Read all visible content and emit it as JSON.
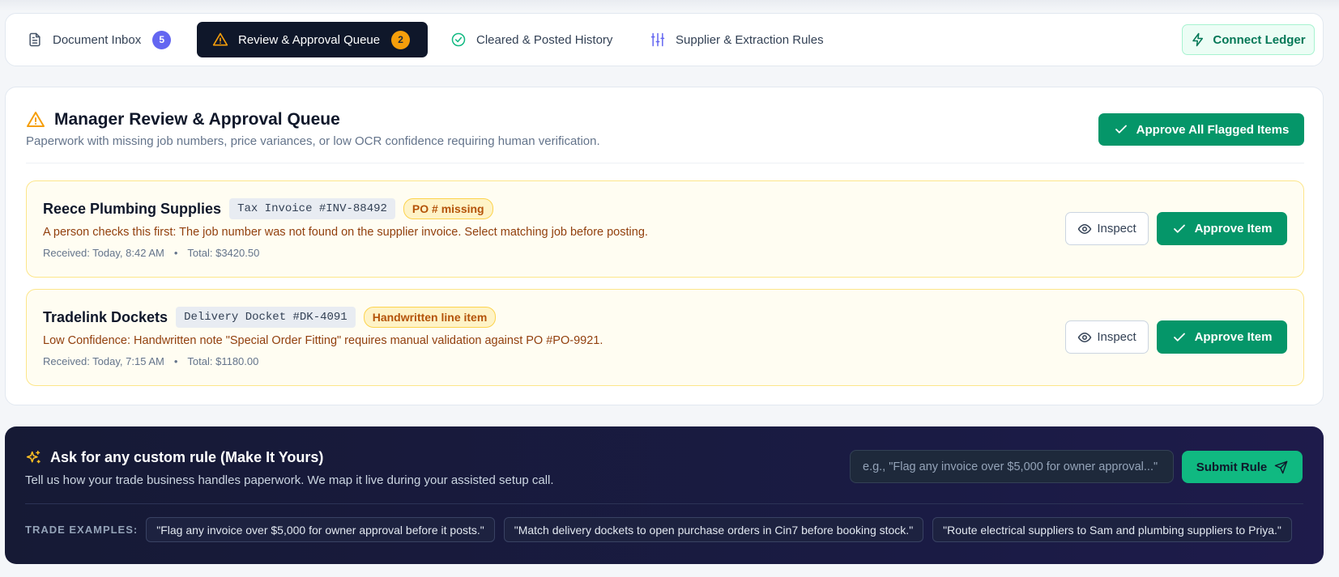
{
  "nav": {
    "tabs": [
      {
        "label": "Document Inbox",
        "count": "5",
        "icon": "document-icon"
      },
      {
        "label": "Review & Approval Queue",
        "count": "2",
        "icon": "warning-icon"
      },
      {
        "label": "Cleared & Posted History",
        "icon": "check-circle-icon"
      },
      {
        "label": "Supplier & Extraction Rules",
        "icon": "sliders-icon"
      }
    ],
    "connect_label": "Connect Ledger"
  },
  "review": {
    "title": "Manager Review & Approval Queue",
    "subtitle": "Paperwork with missing job numbers, price variances, or low OCR confidence requiring human verification.",
    "approve_all_label": "Approve All Flagged Items",
    "items": [
      {
        "supplier": "Reece Plumbing Supplies",
        "doc_ref": "Tax Invoice #INV-88492",
        "flag": "PO # missing",
        "message": "A person checks this first: The job number was not found on the supplier invoice. Select matching job before posting.",
        "received": "Received: Today, 8:42 AM",
        "total": "Total: $3420.50",
        "inspect_label": "Inspect",
        "approve_label": "Approve Item"
      },
      {
        "supplier": "Tradelink Dockets",
        "doc_ref": "Delivery Docket #DK-4091",
        "flag": "Handwritten line item",
        "message": "Low Confidence: Handwritten note \"Special Order Fitting\" requires manual validation against PO #PO-9921.",
        "received": "Received: Today, 7:15 AM",
        "total": "Total: $1180.00",
        "inspect_label": "Inspect",
        "approve_label": "Approve Item"
      }
    ]
  },
  "custom_rule": {
    "title": "Ask for any custom rule (Make It Yours)",
    "subtitle": "Tell us how your trade business handles paperwork. We map it live during your assisted setup call.",
    "input_placeholder": "e.g., \"Flag any invoice over $5,000 for owner approval...\"",
    "submit_label": "Submit Rule",
    "examples_label": "TRADE EXAMPLES:",
    "examples": [
      "\"Flag any invoice over $5,000 for owner approval before it posts.\"",
      "\"Match delivery dockets to open purchase orders in Cin7 before booking stock.\"",
      "\"Route electrical suppliers to Sam and plumbing suppliers to Priya.\""
    ]
  },
  "colors": {
    "accent_green": "#059669",
    "warning_amber": "#f59e0b",
    "inbox_badge": "#6366f1",
    "dark_navy": "#0f172a"
  }
}
